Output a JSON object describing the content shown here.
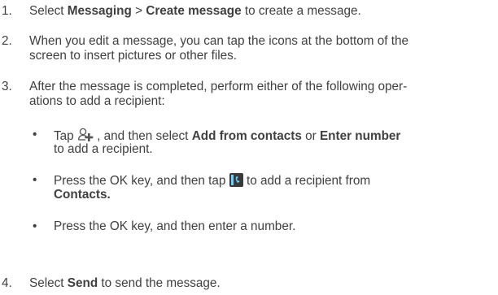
{
  "steps": [
    {
      "num": "1.",
      "pre": "Select ",
      "b1": "Messaging",
      "mid": " > ",
      "b2": "Create message",
      "post": " to create a message."
    },
    {
      "num": "2.",
      "line1": "When you edit a message, you can tap the icons at the bottom of the",
      "line2": "screen to insert pictures or other files."
    },
    {
      "num": "3.",
      "line1": "After the message is completed, perform either of the following oper-",
      "line2": "ations to add a recipient:"
    },
    {
      "num": "4.",
      "pre": "Select ",
      "b1": "Send",
      "post": " to send the message."
    }
  ],
  "bullets": [
    {
      "dot": "•",
      "pre": "Tap ",
      "icon": "add-contact-icon",
      "mid1": " , and then select ",
      "b1": "Add from contacts",
      "mid2": " or ",
      "b2": "Enter number",
      "line2": "to add a recipient."
    },
    {
      "dot": "•",
      "pre": "Press the OK key, and then tap ",
      "icon": "contacts-phone-icon",
      "post": " to add a recipient from",
      "b1": "Contacts."
    },
    {
      "dot": "•",
      "text": "Press the OK key, and then enter a number."
    }
  ],
  "colors": {
    "text": "#404040",
    "contacts_icon_bg": "#3a3a3a",
    "contacts_icon_fg": "#6ad0ff"
  }
}
